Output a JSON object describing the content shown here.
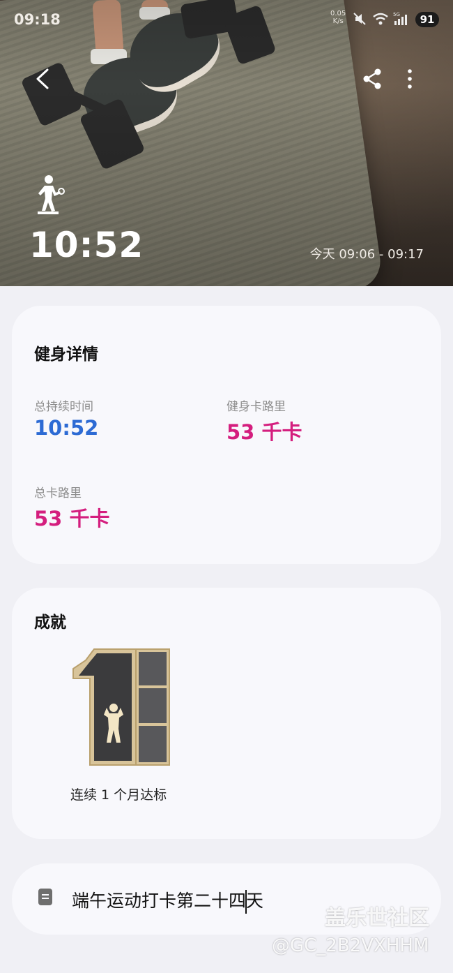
{
  "status_bar": {
    "time": "09:18",
    "net_rate_value": "0.05",
    "net_rate_unit": "K/s",
    "battery": "91"
  },
  "hero": {
    "duration": "10:52",
    "time_range": "今天 09:06 - 09:17",
    "sport_icon": "fitness-person-icon"
  },
  "details": {
    "title": "健身详情",
    "metrics": [
      {
        "label": "总持续时间",
        "value": "10:52",
        "color": "#2d6bd4"
      },
      {
        "label": "健身卡路里",
        "value": "53 千卡",
        "color": "#d41e7e"
      },
      {
        "label": "总卡路里",
        "value": "53 千卡",
        "color": "#d41e7e"
      }
    ]
  },
  "achievement": {
    "title": "成就",
    "badge_label": "连续 1 个月达标",
    "badge_icon": "one-month-streak-badge"
  },
  "note": {
    "text_before_cursor": "端午运动打卡第二十四",
    "text_after_cursor": "天",
    "icon": "note-icon"
  },
  "watermark": {
    "brand": "盖乐世社区",
    "user": "@GC_2B2VXHHM"
  },
  "colors": {
    "accent_blue": "#2d6bd4",
    "accent_pink": "#d41e7e",
    "card_bg": "#f8f8fc",
    "page_bg": "#f0f0f5"
  }
}
